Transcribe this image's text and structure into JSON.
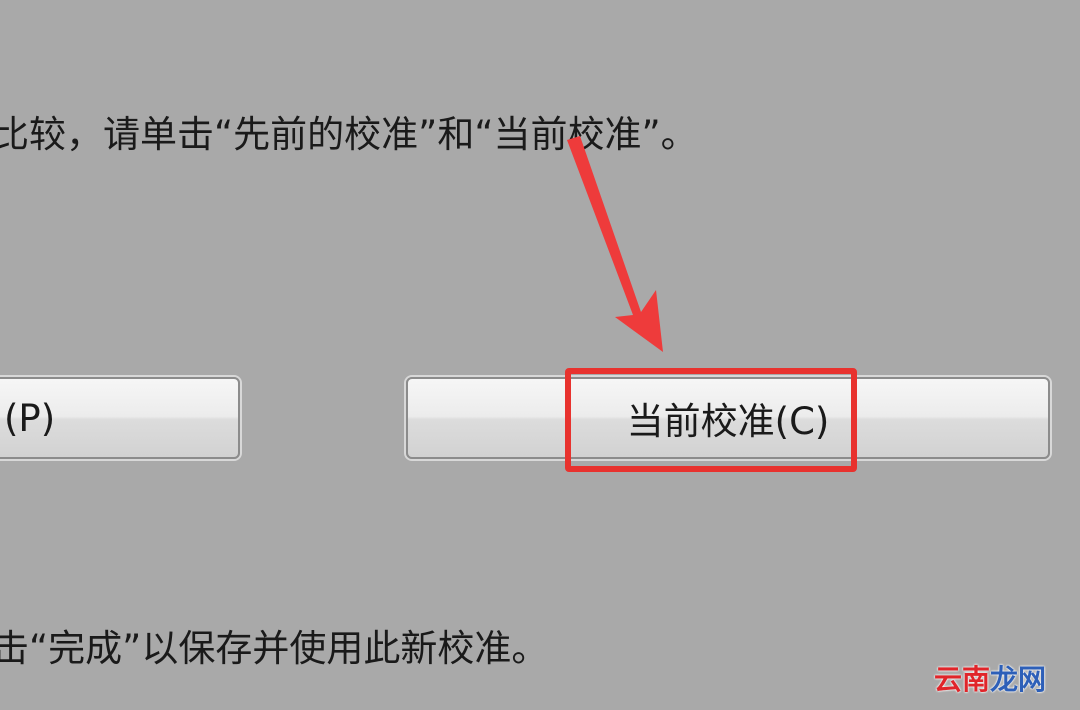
{
  "instructions": {
    "top": "比较，请单击“先前的校准”和“当前校准”。",
    "bottom": "击“完成”以保存并使用此新校准。"
  },
  "buttons": {
    "previous_label": "(P)",
    "current_label": "当前校准(C)"
  },
  "watermark": {
    "part1": "云南",
    "part2": "龙网"
  },
  "colors": {
    "background": "#a9a9a9",
    "highlight": "#e8322e",
    "arrow": "#ee3b3b"
  },
  "icons": {
    "pointer": "red-arrow-icon"
  }
}
